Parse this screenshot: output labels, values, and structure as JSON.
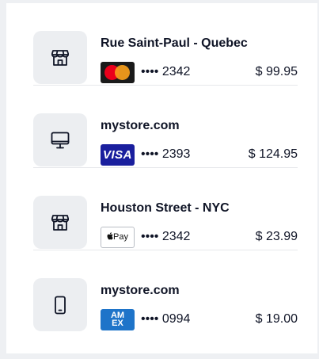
{
  "transactions": [
    {
      "merchant": "Rue Saint-Paul - Quebec",
      "icon": "store-icon",
      "card_brand": "mastercard",
      "card_last4": "•••• 2342",
      "amount": "$ 99.95"
    },
    {
      "merchant": "mystore.com",
      "icon": "monitor-icon",
      "card_brand": "visa",
      "card_label": "VISA",
      "card_last4": "•••• 2393",
      "amount": "$ 124.95"
    },
    {
      "merchant": "Houston Street - NYC",
      "icon": "store-icon",
      "card_brand": "apple-pay",
      "card_label": "Pay",
      "card_last4": "•••• 2342",
      "amount": "$ 23.99"
    },
    {
      "merchant": "mystore.com",
      "icon": "smartphone-icon",
      "card_brand": "american-express",
      "card_label_top": "AM",
      "card_label_bottom": "EX",
      "card_last4": "•••• 0994",
      "amount": "$ 19.00"
    }
  ],
  "colors": {
    "text": "#0f1426",
    "tile_background": "#eceef1",
    "visa_blue": "#1a1f9e",
    "amex_blue": "#1e74c9"
  }
}
